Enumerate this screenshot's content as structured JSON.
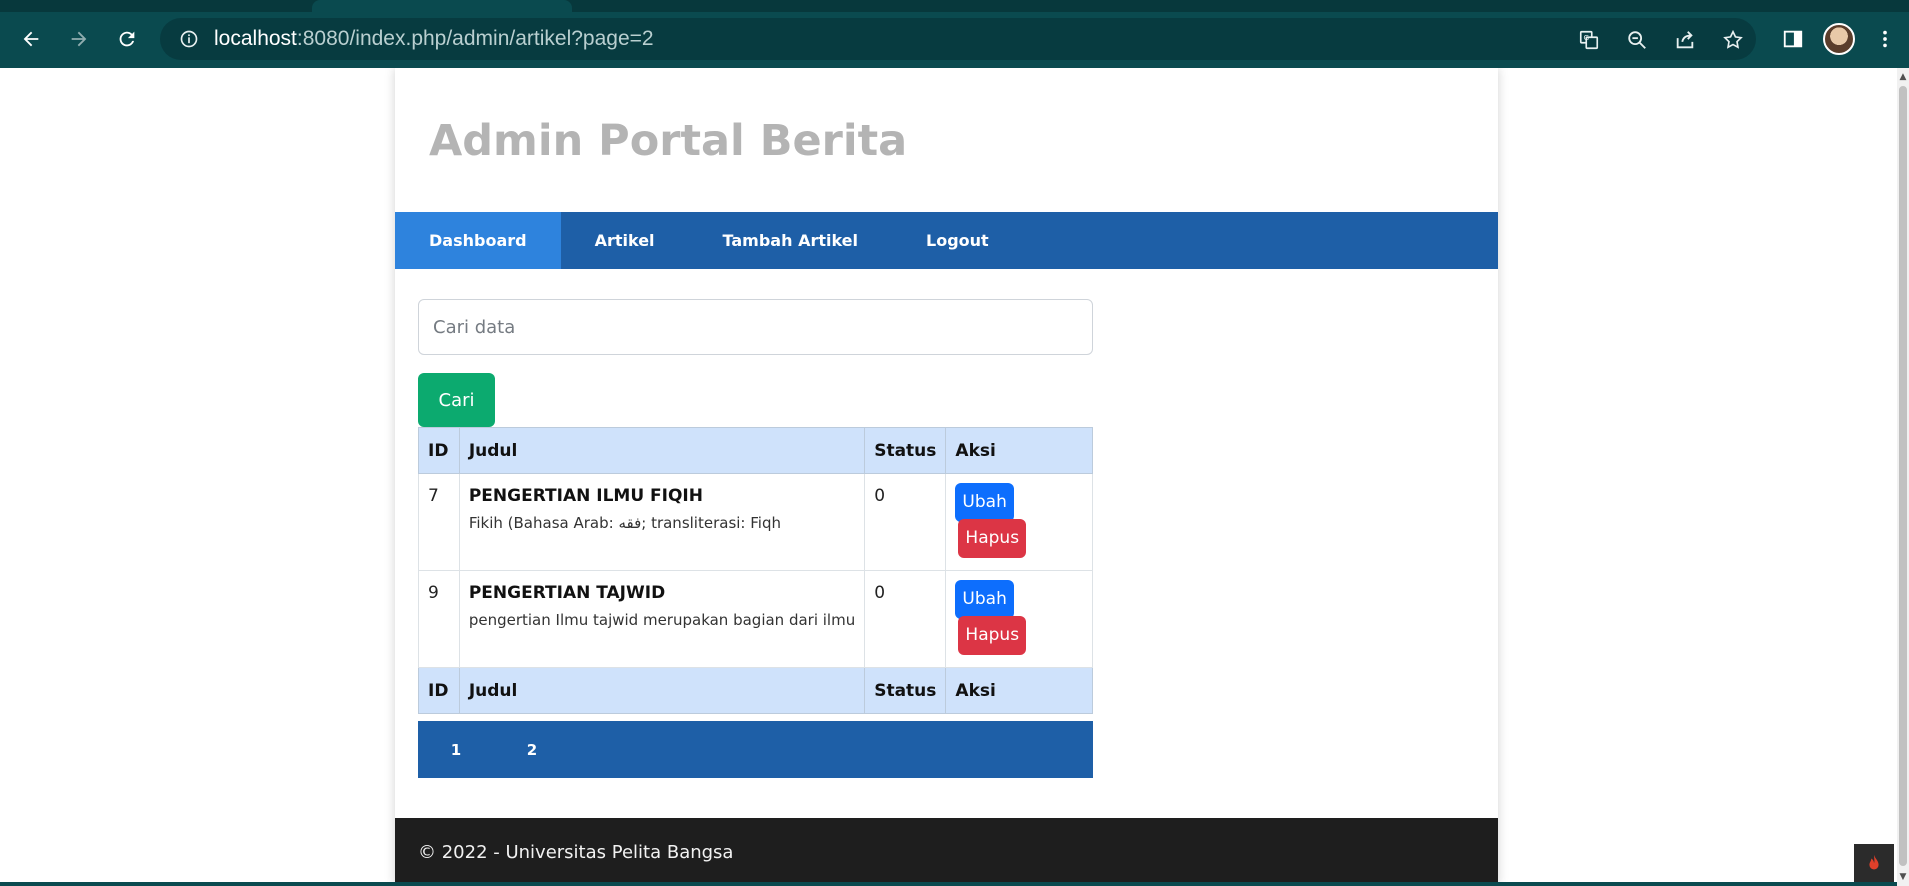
{
  "browser": {
    "url_host": "localhost",
    "url_path": ":8080/index.php/admin/artikel?page=2",
    "icons": [
      "back-icon",
      "forward-icon",
      "reload-icon",
      "info-icon",
      "translate-icon",
      "zoom-out-icon",
      "share-icon",
      "bookmark-star-icon",
      "side-panel-icon",
      "profile-avatar",
      "menu-kebab-icon"
    ]
  },
  "site": {
    "title": "Admin Portal Berita"
  },
  "nav": {
    "items": [
      {
        "label": "Dashboard",
        "active": true
      },
      {
        "label": "Artikel",
        "active": false
      },
      {
        "label": "Tambah Artikel",
        "active": false
      },
      {
        "label": "Logout",
        "active": false
      }
    ]
  },
  "search": {
    "placeholder": "Cari data",
    "value": "",
    "button_label": "Cari"
  },
  "table": {
    "headers": [
      "ID",
      "Judul",
      "Status",
      "Aksi"
    ],
    "rows": [
      {
        "id": "7",
        "title": "PENGERTIAN ILMU FIQIH",
        "snippet": "Fikih (Bahasa Arab: فقه; transliterasi: Fiqh",
        "status": "0",
        "edit_label": "Ubah",
        "delete_label": "Hapus"
      },
      {
        "id": "9",
        "title": "PENGERTIAN TAJWID",
        "snippet": "pengertian Ilmu tajwid merupakan bagian dari ilmu",
        "status": "0",
        "edit_label": "Ubah",
        "delete_label": "Hapus"
      }
    ],
    "footer_headers": [
      "ID",
      "Judul",
      "Status",
      "Aksi"
    ]
  },
  "pagination": {
    "pages": [
      "1",
      "2"
    ]
  },
  "footer": {
    "text": "© 2022 - Universitas Pelita Bangsa"
  },
  "colors": {
    "nav_bg": "#1e5fa7",
    "nav_active": "#2e83dd",
    "search_button": "#0caa6f",
    "edit_button": "#0d6efd",
    "delete_button": "#dc3545",
    "table_header": "#cfe2fb",
    "footer_bg": "#1e1e1e"
  }
}
